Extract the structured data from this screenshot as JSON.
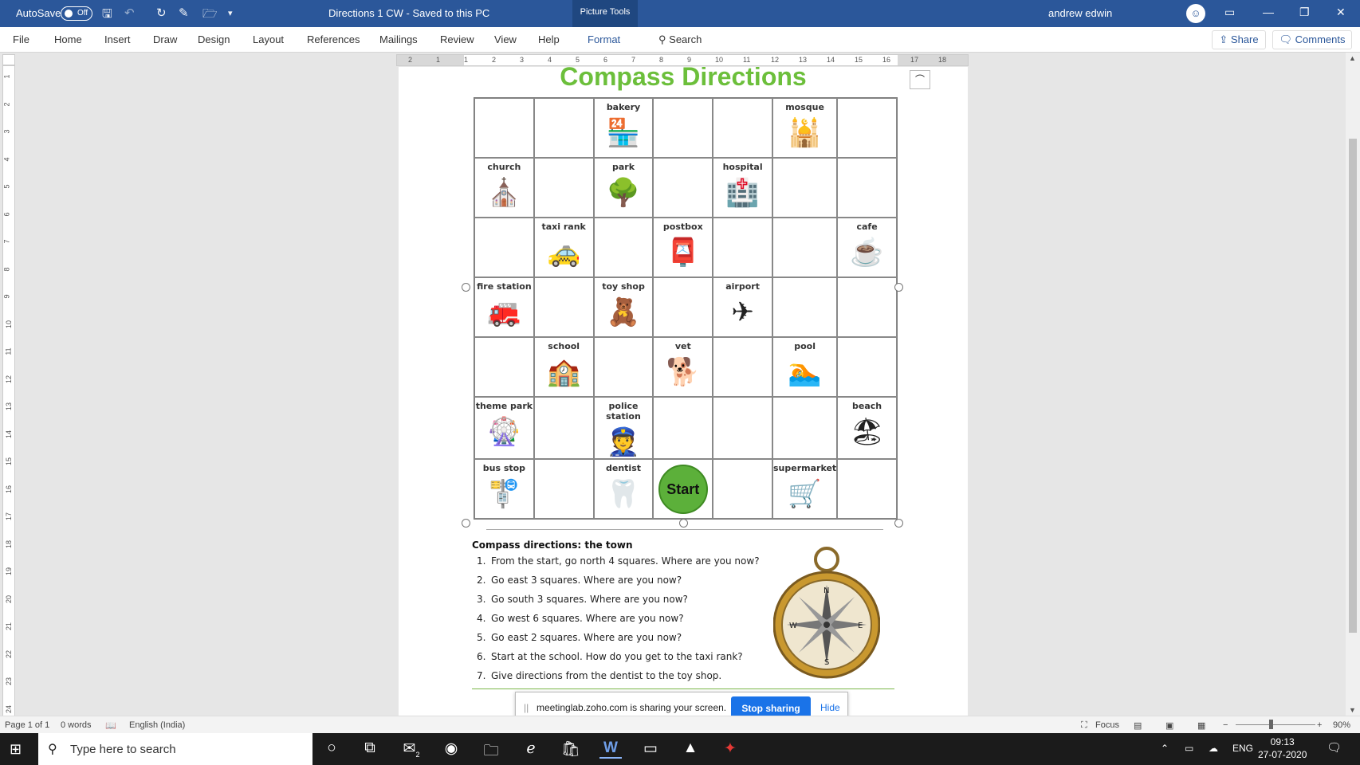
{
  "titlebar": {
    "autosave_label": "AutoSave",
    "autosave_state": "Off",
    "doc_title": "Directions 1 CW - Saved to this PC",
    "context_tab": "Picture Tools",
    "user_name": "andrew edwin"
  },
  "ribbon": {
    "tabs": [
      "File",
      "Home",
      "Insert",
      "Draw",
      "Design",
      "Layout",
      "References",
      "Mailings",
      "Review",
      "View",
      "Help",
      "Format"
    ],
    "search_label": "Search",
    "share_label": "Share",
    "comments_label": "Comments"
  },
  "document": {
    "title": "Compass Directions",
    "grid": [
      [
        {
          "label": "",
          "icon": ""
        },
        {
          "label": "",
          "icon": ""
        },
        {
          "label": "bakery",
          "icon": "🏪"
        },
        {
          "label": "",
          "icon": ""
        },
        {
          "label": "",
          "icon": ""
        },
        {
          "label": "mosque",
          "icon": "🕌"
        },
        {
          "label": "",
          "icon": ""
        }
      ],
      [
        {
          "label": "church",
          "icon": "⛪"
        },
        {
          "label": "",
          "icon": ""
        },
        {
          "label": "park",
          "icon": "🌳"
        },
        {
          "label": "",
          "icon": ""
        },
        {
          "label": "hospital",
          "icon": "🏥"
        },
        {
          "label": "",
          "icon": ""
        },
        {
          "label": "",
          "icon": ""
        }
      ],
      [
        {
          "label": "",
          "icon": ""
        },
        {
          "label": "taxi rank",
          "icon": "🚕"
        },
        {
          "label": "",
          "icon": ""
        },
        {
          "label": "postbox",
          "icon": "📮"
        },
        {
          "label": "",
          "icon": ""
        },
        {
          "label": "",
          "icon": ""
        },
        {
          "label": "cafe",
          "icon": "☕"
        }
      ],
      [
        {
          "label": "fire station",
          "icon": "🚒"
        },
        {
          "label": "",
          "icon": ""
        },
        {
          "label": "toy shop",
          "icon": "🧸"
        },
        {
          "label": "",
          "icon": ""
        },
        {
          "label": "airport",
          "icon": "✈"
        },
        {
          "label": "",
          "icon": ""
        },
        {
          "label": "",
          "icon": ""
        }
      ],
      [
        {
          "label": "",
          "icon": ""
        },
        {
          "label": "school",
          "icon": "🏫"
        },
        {
          "label": "",
          "icon": ""
        },
        {
          "label": "vet",
          "icon": "🐕"
        },
        {
          "label": "",
          "icon": ""
        },
        {
          "label": "pool",
          "icon": "🏊"
        },
        {
          "label": "",
          "icon": ""
        }
      ],
      [
        {
          "label": "theme park",
          "icon": "🎡"
        },
        {
          "label": "",
          "icon": ""
        },
        {
          "label": "police station",
          "icon": "👮"
        },
        {
          "label": "",
          "icon": ""
        },
        {
          "label": "",
          "icon": ""
        },
        {
          "label": "",
          "icon": ""
        },
        {
          "label": "beach",
          "icon": "🏖"
        }
      ],
      [
        {
          "label": "bus stop",
          "icon": "🚏"
        },
        {
          "label": "",
          "icon": ""
        },
        {
          "label": "dentist",
          "icon": "🦷"
        },
        {
          "label": "",
          "icon": "",
          "start": "Start"
        },
        {
          "label": "",
          "icon": ""
        },
        {
          "label": "supermarket",
          "icon": "🛒"
        },
        {
          "label": "",
          "icon": ""
        }
      ]
    ],
    "questions_title": "Compass directions: the town",
    "questions": [
      {
        "num": "1.",
        "text": "From the start, go north 4 squares. Where are you now?"
      },
      {
        "num": "2.",
        "text": "Go east 3 squares. Where are you now?"
      },
      {
        "num": "3.",
        "text": "Go south 3 squares. Where are you now?"
      },
      {
        "num": "4.",
        "text": "Go west 6 squares. Where are you now?"
      },
      {
        "num": "5.",
        "text": "Go east 2 squares. Where are you now?"
      },
      {
        "num": "6.",
        "text": "Start at the school. How do you get to the taxi rank?"
      },
      {
        "num": "7.",
        "text": "Give directions from the dentist to the toy shop."
      }
    ],
    "compass_letters": {
      "n": "N",
      "e": "E",
      "s": "S",
      "w": "W"
    }
  },
  "ruler": {
    "h_ticks": [
      "2",
      "1",
      "1",
      "2",
      "3",
      "4",
      "5",
      "6",
      "7",
      "8",
      "9",
      "10",
      "11",
      "12",
      "13",
      "14",
      "15",
      "16",
      "17",
      "18"
    ],
    "v_ticks": [
      "1",
      "2",
      "3",
      "4",
      "5",
      "6",
      "7",
      "8",
      "9",
      "10",
      "11",
      "12",
      "13",
      "14",
      "15",
      "16",
      "17",
      "18",
      "19",
      "20",
      "21",
      "22",
      "23",
      "24"
    ]
  },
  "screenshare": {
    "message": "meetinglab.zoho.com is sharing your screen.",
    "stop_label": "Stop sharing",
    "hide_label": "Hide"
  },
  "statusbar": {
    "page": "Page 1 of 1",
    "words": "0 words",
    "language": "English (India)",
    "focus": "Focus",
    "zoom": "90%"
  },
  "taskbar": {
    "search_placeholder": "Type here to search",
    "mail_badge": "2",
    "lang": "ENG",
    "time": "09:13",
    "date": "27-07-2020"
  },
  "colors": {
    "title_bar": "#2b579a",
    "heading_green": "#6cbf3b",
    "start_green": "#5cb03a",
    "share_blue": "#1a73e8"
  }
}
